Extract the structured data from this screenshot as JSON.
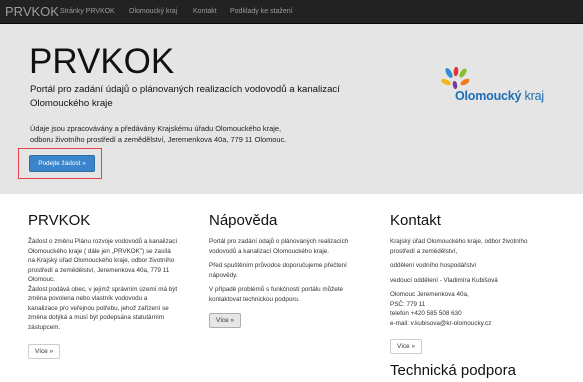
{
  "navbar": {
    "brand": "PRVKOK",
    "links": [
      "Stránky PRVKOK",
      "Olomoucký kraj",
      "Kontakt",
      "Podklady ke stažení"
    ]
  },
  "jumbotron": {
    "title": "PRVKOK",
    "lead_line1": "Portál pro zadání údajů o plánovaných realizacích vodovodů a kanalizací",
    "lead_line2": "Olomouckého kraje",
    "desc_line1": "Údaje jsou zpracovávány a předávány Krajskému úřadu Olomouckého kraje,",
    "desc_line2": "odboru životního prostředí a zemědělství, Jeremenkova 40a, 779 11 Olomouc.",
    "button": "Podejte žádost »"
  },
  "logo": {
    "text_bold": "Olomoucký",
    "text_regular": " kraj"
  },
  "columns": {
    "prvkok": {
      "title": "PRVKOK",
      "lines": [
        "Žádost o změnu Plánu rozvoje vodovodů a kanalizací",
        "Olomouckého kraje ( dále jen „PRVKOK\") se zasílá",
        "na Krajský úřad Olomouckého kraje, odbor životního",
        "prostředí a zemědělství, Jeremenkova 40a, 779 11",
        "Olomouc.",
        "Žádost podává obec, v jejímž správním území má být",
        "změna povolena nebo vlastník vodovodu a",
        "kanalizace pro veřejnou potřebu, jehož zařízení se",
        "změna dotýká a musí být podepsána statutárním",
        "zástupcem."
      ],
      "button": "Více »"
    },
    "napoveda": {
      "title": "Nápověda",
      "p1_line1": "Portál pro zadání údajů o plánovaných realizacích",
      "p1_line2": "vodovodů a kanalizací Olomouckého kraje.",
      "p2_line1": "Před spuštěním průvodce doporučujeme přečtení",
      "p2_line2": "nápovědy.",
      "p3_line1": "V případě problémů s funkčností portálu můžete",
      "p3_line2": "kontaktovat technickou podporu.",
      "button": "Více »"
    },
    "kontakt": {
      "title": "Kontakt",
      "p1_line1": "Krajský úřad Olomouckého kraje, odbor životního",
      "p1_line2": "prostředí a zemědělství,",
      "p2": "oddělení vodního hospodářství",
      "p3": "vedoucí oddělení - Vladimíra Kubišová",
      "address_line1": "Olomouc Jeremenkova 40a,",
      "address_line2": "PSČ: 779 11",
      "phone": "telefon +420 585 508 630",
      "email": "e-mail: v.kubisova@kr-olomoucky.cz",
      "button": "Více »"
    },
    "technical_title": "Technická podpora"
  },
  "colors": {
    "navbar": "#222222",
    "jumbotron": "#e5e5e5",
    "primary": "#3a85cc",
    "highlight": "#e8414d",
    "logo_text": "#1c6fb5"
  }
}
